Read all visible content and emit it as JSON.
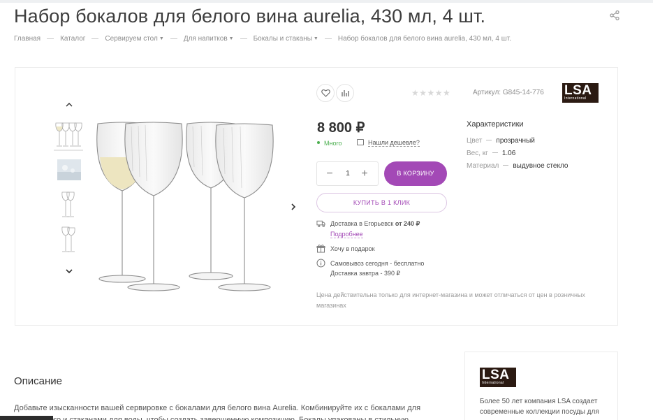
{
  "title": "Набор бокалов для белого вина aurelia, 430 мл, 4 шт.",
  "breadcrumb": [
    {
      "label": "Главная",
      "dropdown": false
    },
    {
      "label": "Каталог",
      "dropdown": false
    },
    {
      "label": "Сервируем стол",
      "dropdown": true
    },
    {
      "label": "Для напитков",
      "dropdown": true
    },
    {
      "label": "Бокалы и стаканы",
      "dropdown": true
    },
    {
      "label": "Набор бокалов для белого вина aurelia, 430 мл, 4 шт.",
      "dropdown": false
    }
  ],
  "product": {
    "article": "Артикул: G845-14-776",
    "rating_stars": "★★★★★",
    "rating": 0,
    "brand_logo_text": "LSA",
    "brand_logo_sub": "International",
    "price": "8 800 ₽",
    "stock": "Много",
    "cheaper": "Нашли дешевле?",
    "quantity": "1",
    "cart_button": "В КОРЗИНУ",
    "one_click_button": "КУПИТЬ В 1 КЛИК",
    "delivery_prefix": "Доставка в Егорьевск",
    "delivery_price": "от 240 ₽",
    "delivery_more": "Подробнее",
    "gift": "Хочу в подарок",
    "pickup": "Самовывоз сегодня - бесплатно",
    "delivery_tomorrow": "Доставка завтра - 390 ₽",
    "note": "Цена действительна только для интернет-магазина и может отличаться от цен в розничных магазинах"
  },
  "characteristics": {
    "title": "Характеристики",
    "rows": [
      {
        "key": "Цвет",
        "value": "прозрачный"
      },
      {
        "key": "Вес, кг",
        "value": "1.06"
      },
      {
        "key": "Материал",
        "value": "выдувное стекло"
      }
    ]
  },
  "description": {
    "title": "Описание",
    "text": "Добавьте изысканности вашей сервировке с бокалами для белого вина Aurelia. Комбинируйте их с бокалами для шампанского и стаканами для воды, чтобы создать завершенную композицию. Бокалы упакованы в стильную"
  },
  "brand_card": {
    "logo_text": "LSA",
    "logo_sub": "International",
    "text": "Более 50 лет компания LSA создает современные коллекции посуды для"
  },
  "colors": {
    "accent": "#a349b6",
    "stock_green": "#4caf50",
    "brand_logo_bg": "#2b1a12"
  },
  "icons": [
    "share-icon",
    "chevron-up-icon",
    "chevron-down-icon",
    "chevron-right-icon",
    "heart-icon",
    "compare-icon",
    "tag-icon",
    "truck-icon",
    "gift-icon",
    "info-icon"
  ]
}
